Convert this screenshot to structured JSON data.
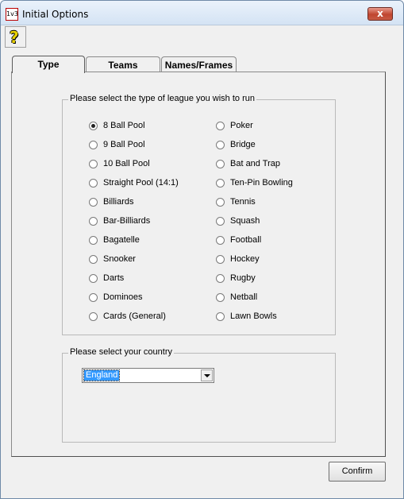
{
  "window": {
    "title": "Initial Options",
    "app_icon_text": "1v3",
    "close_label": "x"
  },
  "toolbar": {
    "help_icon": "question-mark-icon",
    "help_glyph": "?"
  },
  "tabs": [
    {
      "label": "Type",
      "active": true
    },
    {
      "label": "Teams",
      "active": false
    },
    {
      "label": "Names/Frames",
      "active": false
    }
  ],
  "league": {
    "group_label": "Please select the type of league you wish to run",
    "options": [
      {
        "label": "8 Ball Pool",
        "checked": true
      },
      {
        "label": "9 Ball Pool",
        "checked": false
      },
      {
        "label": "10 Ball Pool",
        "checked": false
      },
      {
        "label": "Straight Pool (14:1)",
        "checked": false
      },
      {
        "label": "Billiards",
        "checked": false
      },
      {
        "label": "Bar-Billiards",
        "checked": false
      },
      {
        "label": "Bagatelle",
        "checked": false
      },
      {
        "label": "Snooker",
        "checked": false
      },
      {
        "label": "Darts",
        "checked": false
      },
      {
        "label": "Dominoes",
        "checked": false
      },
      {
        "label": "Cards (General)",
        "checked": false
      },
      {
        "label": "Poker",
        "checked": false
      },
      {
        "label": "Bridge",
        "checked": false
      },
      {
        "label": "Bat and Trap",
        "checked": false
      },
      {
        "label": "Ten-Pin Bowling",
        "checked": false
      },
      {
        "label": "Tennis",
        "checked": false
      },
      {
        "label": "Squash",
        "checked": false
      },
      {
        "label": "Football",
        "checked": false
      },
      {
        "label": "Hockey",
        "checked": false
      },
      {
        "label": "Rugby",
        "checked": false
      },
      {
        "label": "Netball",
        "checked": false
      },
      {
        "label": "Lawn Bowls",
        "checked": false
      }
    ]
  },
  "country": {
    "group_label": "Please select your country",
    "selected": "England"
  },
  "footer": {
    "confirm_label": "Confirm"
  },
  "colors": {
    "selection": "#3399ff",
    "close_button": "#c0452f",
    "window_bg": "#f0f0f0"
  }
}
